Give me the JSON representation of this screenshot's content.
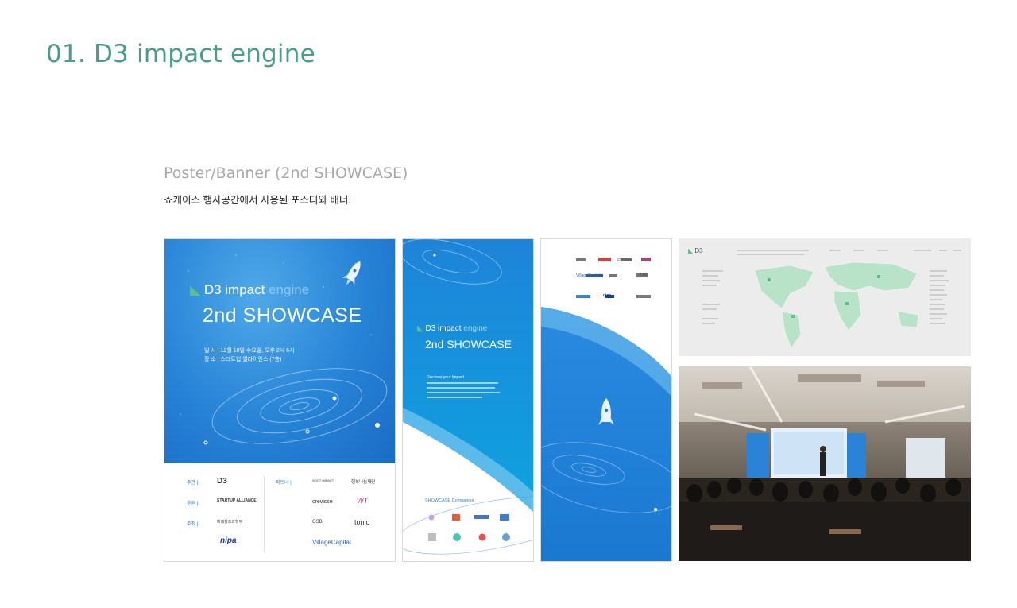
{
  "page": {
    "title": "01. D3 impact engine",
    "subtitle": "Poster/Banner (2nd SHOWCASE)",
    "description": "쇼케이스 행사공간에서 사용된 포스터와 배너."
  },
  "colors": {
    "title": "#4a9e83",
    "subtitle": "#a8a8a8",
    "poster_blue": "#2683d6",
    "accent_green": "#5cbf8c"
  },
  "poster": {
    "brand_main": "D3 impact",
    "brand_light": "engine",
    "showcase": "2nd SHOWCASE",
    "date_line": "일 시 | 12월 10일 수요일, 오후 2시 6시",
    "place_line": "장 소 | 스타트업 얼라이언스 (7층)",
    "label_host": "주관 |",
    "label_support": "후원 |",
    "label_sponsor": "주최 |",
    "label_partner": "파트너 |",
    "logos_left": [
      "D3",
      "STARTUP ALLIANCE",
      "미래창조과학부",
      "nipa"
    ],
    "logos_right": [
      "SOOT IMPACT",
      "행복나눔재단",
      "crevisse",
      "WT",
      "GSBI",
      "tonic",
      "VillageCapital"
    ]
  },
  "banner_a": {
    "brand_main": "D3 impact",
    "brand_light": "engine",
    "showcase": "2nd SHOWCASE",
    "discover": "Discover your Impact",
    "companies": "SHOWCASE Companies"
  },
  "banner_b": {
    "row1": [
      "crevisse",
      "tonic",
      "VillageCapital",
      "nipa"
    ]
  },
  "map_panel": {
    "brand": "D3"
  }
}
